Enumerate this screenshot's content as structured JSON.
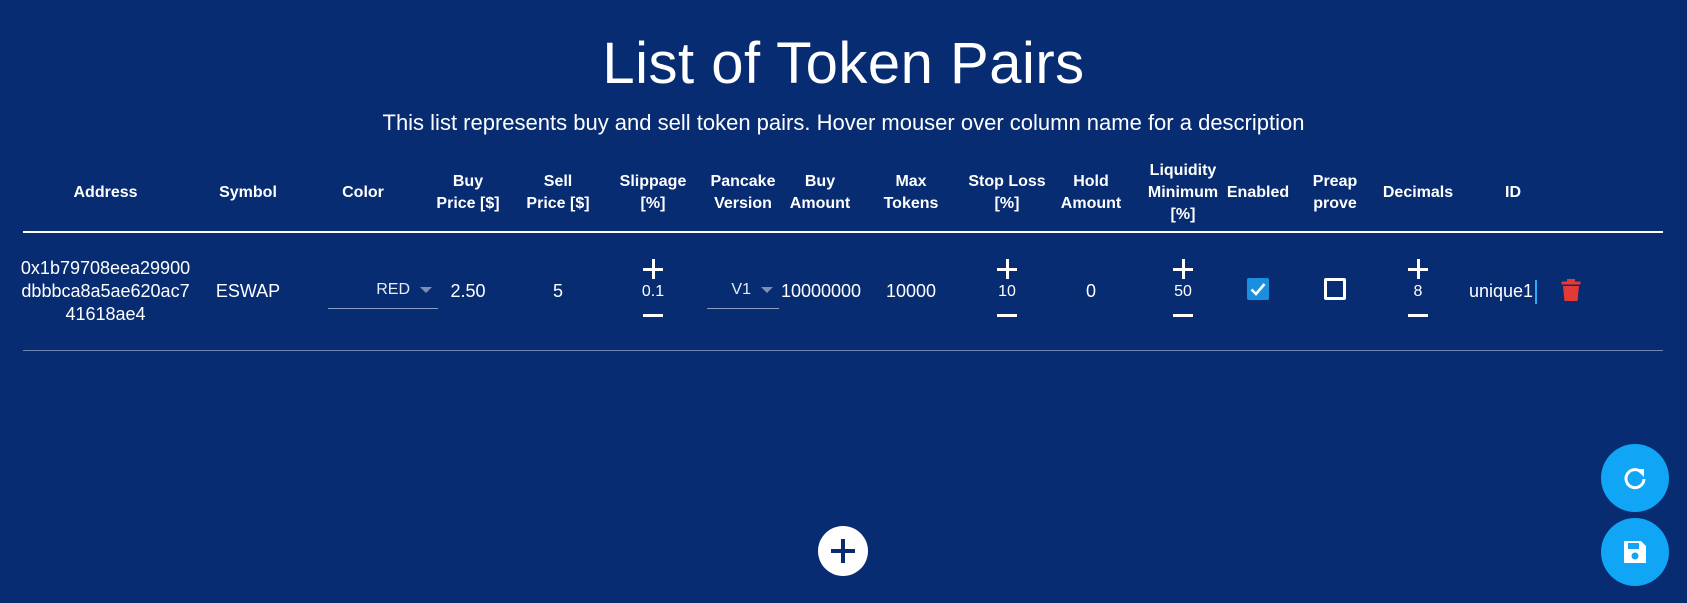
{
  "title": "List of Token Pairs",
  "subtitle": "This list represents buy and sell token pairs. Hover mouser over column name for a description",
  "columns": {
    "address": "Address",
    "symbol": "Symbol",
    "color": "Color",
    "buy_price": "Buy Price [$]",
    "sell_price": "Sell Price [$]",
    "slippage": "Slippage [%]",
    "pancake_version": "Pancake Version",
    "buy_amount": "Buy Amount",
    "max_tokens": "Max Tokens",
    "stop_loss": "Stop Loss [%]",
    "hold_amount": "Hold Amount",
    "liquidity_minimum": "Liquidity Minimum [%]",
    "enabled": "Enabled",
    "preapprove": "Preap prove",
    "decimals": "Decimals",
    "id": "ID"
  },
  "rows": [
    {
      "address": "0x1b79708eea29900dbbbca8a5ae620ac741618ae4",
      "address_lines": [
        "0x1b79708eea29900",
        "dbbbca8a5ae620ac7",
        "41618ae4"
      ],
      "symbol": "ESWAP",
      "color": "RED",
      "buy_price": "2.50",
      "sell_price": "5",
      "slippage": "0.1",
      "pancake_version": "V1",
      "buy_amount": "10000000",
      "max_tokens": "10000",
      "stop_loss": "10",
      "hold_amount": "0",
      "liquidity_minimum": "50",
      "enabled": true,
      "preapprove": false,
      "decimals": "8",
      "id": "unique1"
    }
  ],
  "icons": {
    "add_row": "plus-icon",
    "refresh": "refresh-icon",
    "save": "save-icon",
    "delete": "trash-icon"
  },
  "colors": {
    "background": "#072c72",
    "fab": "#10a5f5",
    "checkbox": "#1a8fe0",
    "delete": "#e53935"
  }
}
